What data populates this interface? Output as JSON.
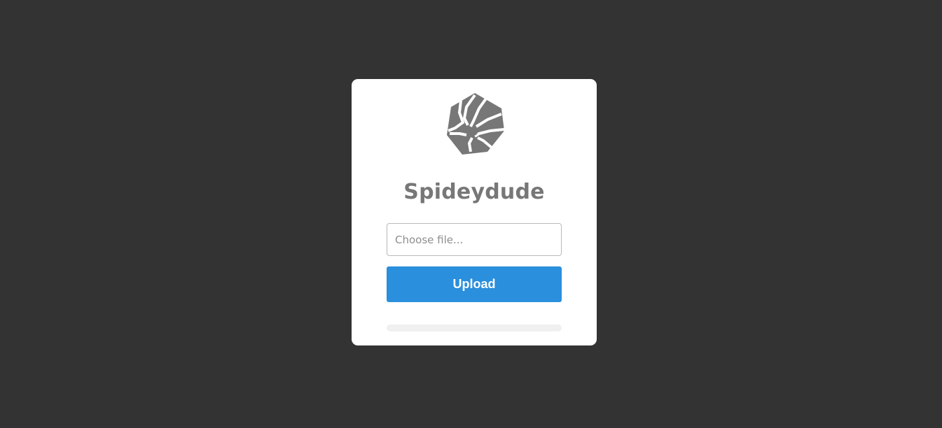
{
  "app": {
    "title": "Spideydude"
  },
  "upload_form": {
    "file_input_placeholder": "Choose file...",
    "upload_button_label": "Upload",
    "progress_percent": 0
  },
  "logo": {
    "icon": "spider-hexagon-logo-icon"
  },
  "colors": {
    "background": "#333333",
    "card": "#ffffff",
    "title": "#777777",
    "accent": "#2a8fdc",
    "logo": "#777777"
  }
}
